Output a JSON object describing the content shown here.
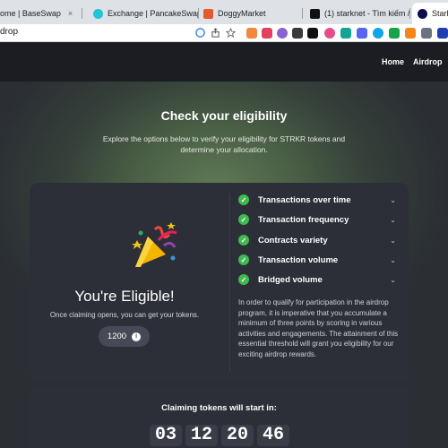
{
  "browser": {
    "tabs": [
      {
        "title": "ome | BaseSwap",
        "favicon_color": "#2a55d9"
      },
      {
        "title": "Exchange | PancakeSwap",
        "favicon_color": "#1fc7d4"
      },
      {
        "title": "DoggyMarket",
        "favicon_color": "#e35a2c"
      },
      {
        "title": "(1) starknet - Tìm kiếm / X",
        "favicon_color": "#111111"
      },
      {
        "title": "Stark",
        "favicon_color": "#0c0c4f"
      }
    ],
    "url": "drop",
    "close_glyph": "×",
    "extension_colors": [
      "#f0883e",
      "#e4405f",
      "#8a63d2",
      "#3a3a3a",
      "#e44d8a",
      "#12a594",
      "#5865f2",
      "#f6851b",
      "#16a34a",
      "#6b7280",
      "#2563eb",
      "#0ea5e9",
      "#1e40af"
    ]
  },
  "nav": {
    "home": "Home",
    "airdrop": "Airdrop"
  },
  "hero": {
    "title": "Check your eligibility",
    "subtitle": "Explore the options below to verify your eligibility for STRKR tokens and determine your allocation."
  },
  "eligibility": {
    "title": "You're Eligible!",
    "subtitle": "Once claiming opens, you can get your tokens.",
    "points": "1200",
    "info_glyph": "i"
  },
  "criteria": [
    {
      "label": "Transactions over time"
    },
    {
      "label": "Transaction frequency"
    },
    {
      "label": "Contracts variety"
    },
    {
      "label": "Transaction volume"
    },
    {
      "label": "Bridged volume"
    }
  ],
  "criteria_check_glyph": "✓",
  "criteria_chevron_glyph": "⌄",
  "description": "In order to qualify for participation in the airdrop program, it is imperative that you accumulate a minimum of three points by scoring in various activities and engagements. The attainment of this essential threshold will grant you eligibility for our exciting airdrop rewards.",
  "claim": {
    "title": "Claiming tokens will start in:",
    "countdown": [
      "03",
      "12",
      "20",
      "46"
    ]
  }
}
